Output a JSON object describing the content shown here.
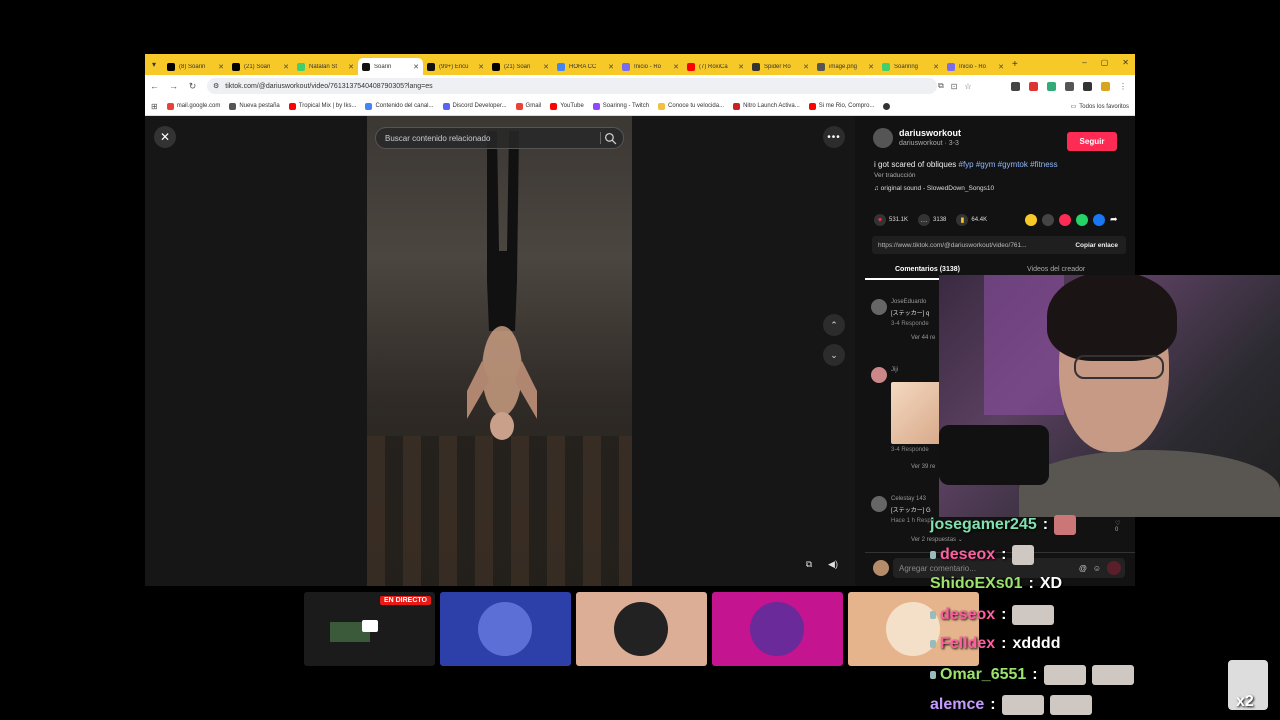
{
  "browser": {
    "tabs": [
      {
        "title": "(8) Soarin",
        "color": "#000000"
      },
      {
        "title": "(21) Soari",
        "color": "#000000"
      },
      {
        "title": "Natalan St",
        "color": "#3fcf6f"
      },
      {
        "title": "Soarin",
        "color": "#111111"
      },
      {
        "title": "(99+) Encu",
        "color": "#111111"
      },
      {
        "title": "(21) Soari",
        "color": "#000000"
      },
      {
        "title": "HORA CC",
        "color": "#4285f4"
      },
      {
        "title": "Inicio - Ro",
        "color": "#7a6cf0"
      },
      {
        "title": "(7) RoxiCa",
        "color": "#ff0000"
      },
      {
        "title": "Spider Ro",
        "color": "#333333"
      },
      {
        "title": "image.png",
        "color": "#555555"
      },
      {
        "title": "Soarinng",
        "color": "#3fcf6f"
      },
      {
        "title": "Inicio - Ro",
        "color": "#7a6cf0"
      }
    ],
    "url": "tiktok.com/@dariusworkout/video/7613137540408790305?lang=es",
    "bookmarks": [
      {
        "label": "mail.google.com",
        "color": "#ea4335"
      },
      {
        "label": "Nueva pestaña",
        "color": "#555555"
      },
      {
        "label": "Tropical Mix | by Iks...",
        "color": "#ff0000"
      },
      {
        "label": "Contenido del canal...",
        "color": "#4285f4"
      },
      {
        "label": "Discord Developer...",
        "color": "#5865f2"
      },
      {
        "label": "Gmail",
        "color": "#ea4335"
      },
      {
        "label": "YouTube",
        "color": "#ff0000"
      },
      {
        "label": "Soarinng - Twitch",
        "color": "#9146ff"
      },
      {
        "label": "Conoce tu velocida...",
        "color": "#f0c040"
      },
      {
        "label": "Nitro Launch Activa...",
        "color": "#cc2222"
      },
      {
        "label": "Si me Rio, Compro...",
        "color": "#ff0000"
      }
    ],
    "bookmarks_all": "Todos los favoritos"
  },
  "player": {
    "search_placeholder": "Buscar contenido relacionado"
  },
  "post": {
    "author": "dariusworkout",
    "author_sub": "dariusworkout · 3-3",
    "follow_label": "Seguir",
    "desc_text": "i got scared of obliques ",
    "desc_tags": "#fyp #gym #gymtok #fitness",
    "translate": "Ver traducción",
    "sound": "♫ original sound - SlowedDown_Songs10",
    "likes": "531.1K",
    "comments": "3138",
    "saves": "64.4K",
    "link": "https://www.tiktok.com/@dariusworkout/video/761...",
    "copy_link": "Copiar enlace",
    "tab_comments": "Comentarios (3138)",
    "tab_creator": "Videos del creador"
  },
  "comments": [
    {
      "name": "JoseEduardo",
      "text": "[ステッカー] q",
      "meta": "3-4  Responde",
      "more": "Ver 44 re"
    },
    {
      "name": "Jiji",
      "text": "",
      "meta": "3-4  Responde",
      "more": "Ver 39 re"
    },
    {
      "name": "Celestay 143",
      "text": "[ステッカー] G",
      "meta": "Hace 1 h   Respo",
      "more": "Ver 2 respuestas ⌄",
      "likes": "♡ 0"
    }
  ],
  "comment_input": {
    "placeholder": "Agregar comentario..."
  },
  "live_badge": "EN DIRECTO",
  "chat": [
    {
      "user": "josegamer245",
      "color": "#7fe0b0",
      "msg": ""
    },
    {
      "user": "deseox",
      "color": "#ff5fa0",
      "msg": ""
    },
    {
      "user": "ShidoEXs01",
      "color": "#9be36b",
      "msg": "XD"
    },
    {
      "user": "deseox",
      "color": "#ff5fa0",
      "msg": ""
    },
    {
      "user": "Felldex",
      "color": "#ff5fa0",
      "msg": "xdddd"
    },
    {
      "user": "Omar_6551",
      "color": "#9be36b",
      "msg": ""
    },
    {
      "user": "alemce",
      "color": "#c39bff",
      "msg": ""
    }
  ],
  "emote_multiplier": "x2"
}
